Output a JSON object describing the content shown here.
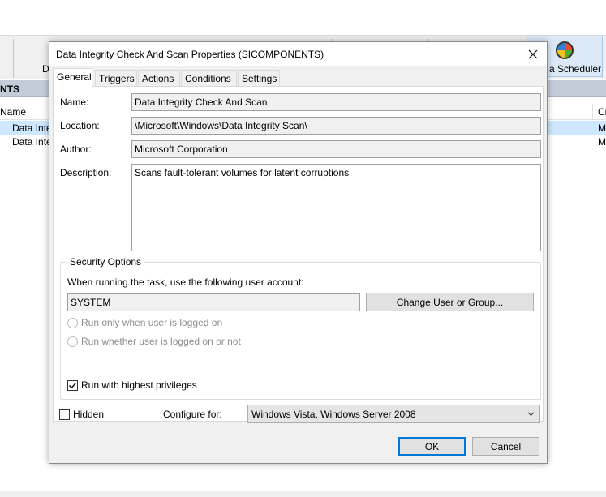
{
  "background": {
    "toolbar_button_d": "D",
    "scheduler_label": "a Scheduler",
    "header_label": "NTS",
    "column_name": "Name",
    "column_right": "Cr",
    "rows": [
      {
        "name": "Data Inte",
        "right": "Mi"
      },
      {
        "name": "Data Inte",
        "right": "Mi"
      }
    ]
  },
  "dialog": {
    "title": "Data Integrity Check And Scan Properties (SICOMPONENTS)",
    "tabs": [
      "General",
      "Triggers",
      "Actions",
      "Conditions",
      "Settings"
    ],
    "active_tab": "General",
    "name_label": "Name:",
    "name_value": "Data Integrity Check And Scan",
    "location_label": "Location:",
    "location_value": "\\Microsoft\\Windows\\Data Integrity Scan\\",
    "author_label": "Author:",
    "author_value": "Microsoft Corporation",
    "description_label": "Description:",
    "description_value": "Scans fault-tolerant volumes for latent corruptions",
    "security": {
      "title": "Security Options",
      "account_prompt": "When running the task, use the following user account:",
      "account_value": "SYSTEM",
      "change_button": "Change User or Group...",
      "radio_logged_on": "Run only when user is logged on",
      "radio_whether": "Run whether user is logged on or not",
      "highest_privileges": "Run with highest privileges",
      "highest_privileges_checked": true
    },
    "hidden_label": "Hidden",
    "hidden_checked": false,
    "configure_label": "Configure for:",
    "configure_value": "Windows Vista, Windows Server 2008",
    "ok_button": "OK",
    "cancel_button": "Cancel"
  },
  "colors": {
    "accent": "#0078d7",
    "selection": "#cde8ff",
    "header_band": "#c3ccd8"
  }
}
